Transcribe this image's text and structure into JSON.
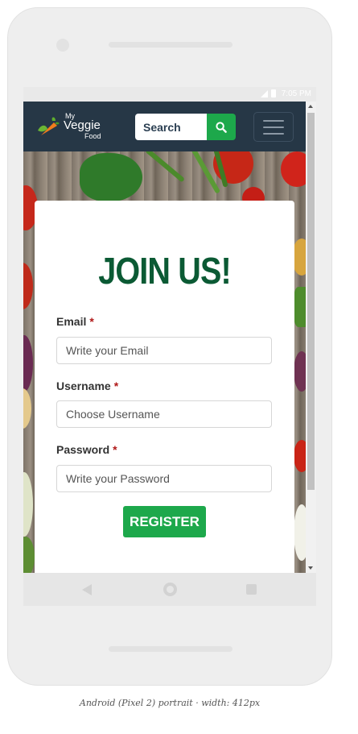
{
  "status_bar": {
    "time": "7:05 PM"
  },
  "header": {
    "logo": {
      "line1": "My",
      "line2": "Veggie",
      "line3": "Food"
    },
    "search": {
      "placeholder": "Search"
    },
    "colors": {
      "navbar": "#263746",
      "accent": "#1da84b"
    }
  },
  "form": {
    "title": "JOIN US!",
    "fields": [
      {
        "label": "Email",
        "required_mark": "*",
        "placeholder": "Write your Email"
      },
      {
        "label": "Username",
        "required_mark": "*",
        "placeholder": "Choose Username"
      },
      {
        "label": "Password",
        "required_mark": "*",
        "placeholder": "Write your Password"
      }
    ],
    "submit_label": "REGISTER",
    "title_color": "#0b5a34"
  },
  "icons": {
    "search": "search-icon",
    "menu": "hamburger-menu-icon",
    "back": "back-icon",
    "home": "home-icon",
    "recent": "recent-apps-icon"
  },
  "caption": "Android (Pixel 2) portrait · width: 412px"
}
